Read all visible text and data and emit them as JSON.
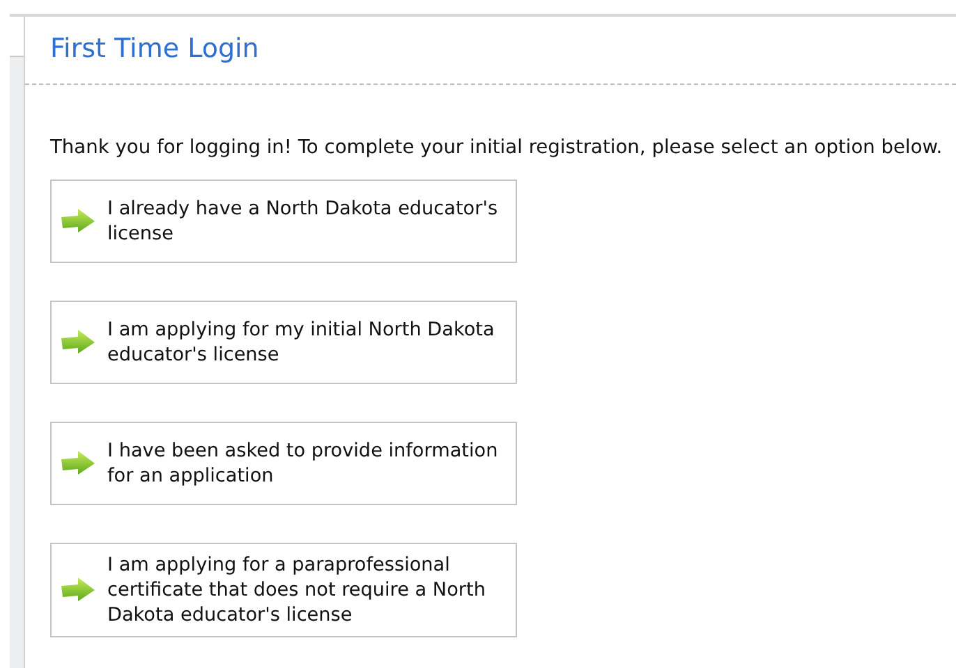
{
  "title": "First Time Login",
  "intro": "Thank you for logging in! To complete your initial registration, please select an option below.",
  "options": [
    {
      "label": "I already have a North Dakota educator's license"
    },
    {
      "label": "I am applying for my initial North Dakota educator's license"
    },
    {
      "label": "I have been asked to provide information for an application"
    },
    {
      "label": "I am applying for a paraprofessional certificate that does not require a North Dakota educator's license"
    }
  ]
}
